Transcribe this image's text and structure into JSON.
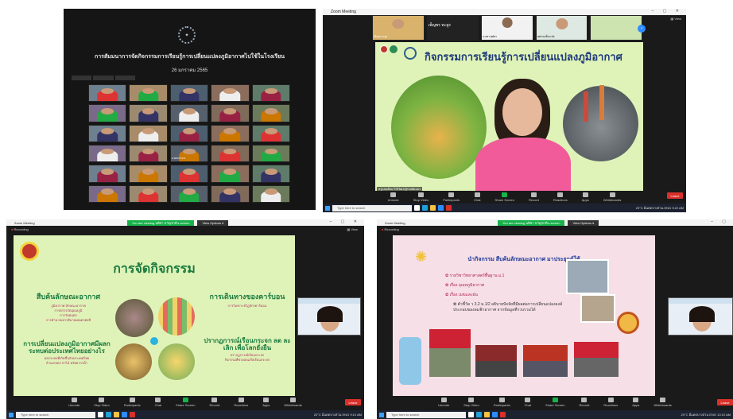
{
  "q1": {
    "title": "การสัมมนาการจัดกิจกรรมการเรียนรู้การเปลี่ยนแปลงภูมิอากาศไปใช้ในโรงเรียน",
    "date": "26 มกราคม 2565",
    "tile_label": "นายสมชาย ส"
  },
  "q2": {
    "window_title": "Zoom Meeting",
    "view_label": "View",
    "strip_names": [
      "เพ็ญพร ทะสูง",
      "เพ็ญพร ทะสูง",
      "นางสาวสุนิสา",
      "สุพรรณ ยิ้มละมัย",
      ""
    ],
    "slide_title": "กิจกรรมการเรียนรู้การเปลี่ยนแปลงภูมิอากาศ",
    "speaker_caption": "ครูแสงเดือน ไร่ภิวัฒน์ ผู้ร่วมสัมมนา"
  },
  "q3": {
    "window_title": "Zoom Meeting",
    "banner_text": "You are viewing นพิชา ขวัญชาติ's screen",
    "view_options": "View Options ▾",
    "recording": "Recording",
    "view_label": "View",
    "slide_heading": "การจัดกิจกรรม",
    "left_top_title": "สืบค้นลักษณะอากาศ",
    "left_top_items": [
      "ภูมิอากาศ ลักษณะอากาศ",
      "การตรวจวัดอุณหภูมิ",
      "การวัดฝนตก",
      "การคำนวณหาปริมาณฝนตกต่อปี"
    ],
    "left_bottom_title": "การเปลี่ยนแปลงภูมิอากาศมีผลกระทบต่อประเทศไทยอย่างไร",
    "left_bottom_items": [
      "ผลกระทบที่เกิดขึ้นกับประเทศไทย",
      "ด้านเกษตร ป่าไม้ ทรัพยากรน้ำ"
    ],
    "right_top_title": "การเดินทางของคาร์บอน",
    "right_top_items": [
      "การวิเคราะห์วัฏจักรคาร์บอน"
    ],
    "right_bottom_title": "ปรากฏการณ์เรือนกระจก ลด ละเลิก เพื่อโลกยั่งยืน",
    "right_bottom_items": [
      "ปรากฏการณ์เรือนกระจก",
      "กิจกรรมที่ช่วยลดแก๊สเรือนกระจก"
    ]
  },
  "q4": {
    "window_title": "Zoom Meeting",
    "banner_text": "You are viewing นพิชา ขวัญชาติ's screen",
    "view_options": "View Options ▾",
    "recording": "Recording",
    "slide_title": "นำกิจกรรม สืบค้นลักษณะอากาศ มาประยุกต์ใช้",
    "items": [
      "รายวิชาวิทยาศาสตร์พื้นฐาน ม.1",
      "เรื่อง อุณหภูมิอากาศ",
      "เรื่อง เมฆและฝน",
      "ตัวชี้วัด ว 3.2 ม.1/2 อธิบายปัจจัยที่มีผลต่อการเปลี่ยนแปลงองค์ประกอบของลมฟ้าอากาศ จากข้อมูลที่รวบรวมได้"
    ]
  },
  "zoom_controls": {
    "unmute": "Unmute",
    "stop_video": "Stop Video",
    "participants": "Participants",
    "chat": "Chat",
    "share": "Share Screen",
    "record": "Record",
    "reactions": "Reactions",
    "apps": "Apps",
    "whiteboards": "Whiteboards",
    "leave": "Leave"
  },
  "taskbar": {
    "search_placeholder": "Type here to search",
    "weather": "20°C มีแดดบางส่วน",
    "lang": "ENG",
    "time_q2": "9:22 AM",
    "date_q2": "8/26/2022",
    "time_q3": "9:10 AM",
    "date_q3": "8/26/2022",
    "time_q4": "10:10 AM",
    "date_q4": "8/26/2022"
  },
  "colors": {
    "zoom_dark": "#1a1a1a",
    "slide_green": "#dff3b8",
    "slide_pink": "#f6dfe6",
    "leave_red": "#d9302b",
    "share_green": "#17b34a"
  }
}
